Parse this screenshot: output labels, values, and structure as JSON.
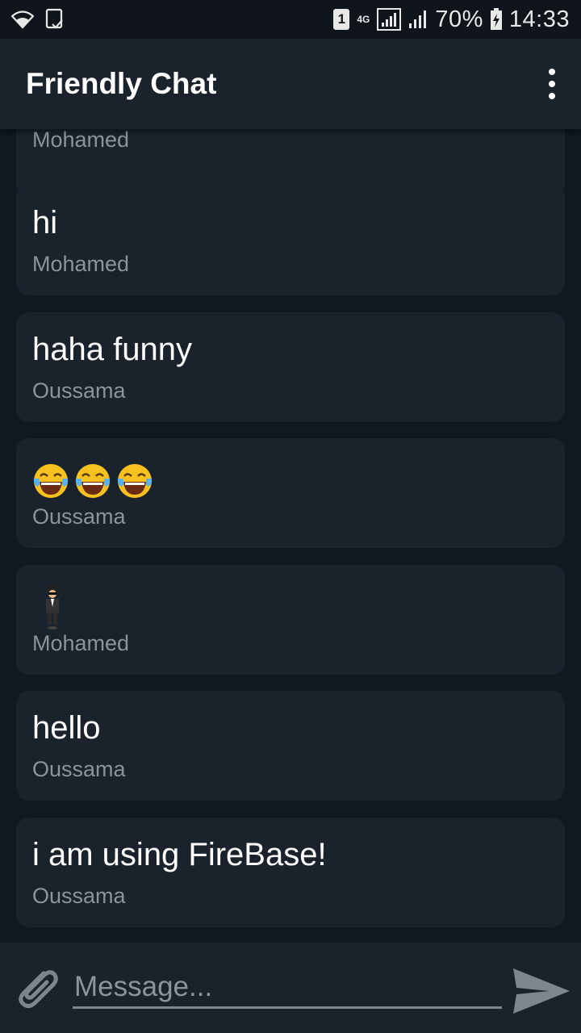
{
  "status_bar": {
    "sim_slot": "1",
    "network_type": "4G",
    "battery": "70%",
    "time": "14:33"
  },
  "app_bar": {
    "title": "Friendly Chat",
    "menu_icon": "more-vert-icon"
  },
  "messages": [
    {
      "text": "",
      "author": "Mohamed"
    },
    {
      "text": "hi",
      "author": "Mohamed"
    },
    {
      "text": "haha funny",
      "author": "Oussama"
    },
    {
      "text": "😂😂😂",
      "author": "Oussama",
      "emoji": "face-with-tears-of-joy"
    },
    {
      "text": "🕴",
      "author": "Mohamed",
      "emoji": "man-in-business-suit-levitating"
    },
    {
      "text": "hello",
      "author": "Oussama"
    },
    {
      "text": "i am using FireBase!",
      "author": "Oussama"
    }
  ],
  "composer": {
    "placeholder": "Message...",
    "value": "",
    "attach_icon": "paperclip-icon",
    "send_icon": "send-icon"
  },
  "colors": {
    "background": "#111820",
    "card": "#1a222b",
    "secondary_text": "#8b949b",
    "primary_text": "#ffffff"
  }
}
